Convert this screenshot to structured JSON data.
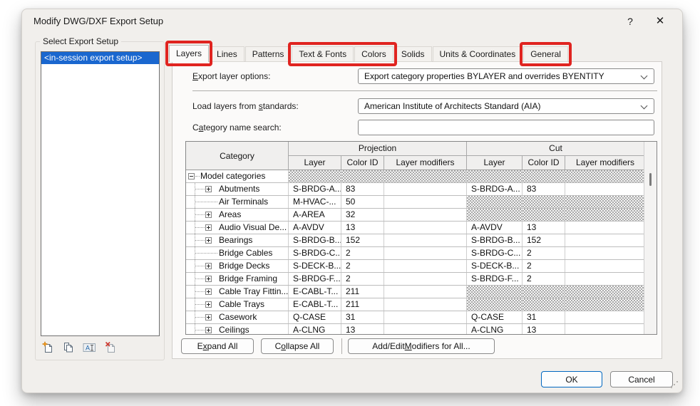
{
  "colors": {
    "annotation_red": "#e02420",
    "selection_blue": "#1a67cf",
    "ok_border_blue": "#0067c0"
  },
  "window": {
    "title": "Modify DWG/DXF Export Setup",
    "help_glyph": "?",
    "close_glyph": "✕"
  },
  "left_panel": {
    "group_label": "Select Export Setup",
    "list_items": [
      {
        "label": "<in-session export setup>",
        "selected": true
      }
    ],
    "toolbar_icons": [
      "new-export-setup",
      "duplicate-export-setup",
      "rename-export-setup",
      "delete-export-setup"
    ]
  },
  "tabs": [
    {
      "label": "Layers",
      "active": true,
      "highlight": true
    },
    {
      "label": "Lines"
    },
    {
      "label": "Patterns"
    },
    {
      "label": "Text & Fonts",
      "highlight": true
    },
    {
      "label": "Colors",
      "highlight": true
    },
    {
      "label": "Solids"
    },
    {
      "label": "Units & Coordinates"
    },
    {
      "label": "General",
      "highlight": true
    }
  ],
  "fields": {
    "export_layer_options": {
      "label": {
        "pre": "",
        "accel": "E",
        "post": "xport layer options:"
      },
      "value": "Export category properties BYLAYER and overrides BYENTITY"
    },
    "load_layers": {
      "label": {
        "pre": "Load layers from ",
        "accel": "s",
        "post": "tandards:"
      },
      "value": "American Institute of Architects Standard (AIA)"
    },
    "category_search": {
      "label": {
        "pre": "C",
        "accel": "a",
        "post": "tegory name search:"
      },
      "value": "",
      "placeholder": ""
    }
  },
  "table": {
    "headers": {
      "category": "Category",
      "projection": "Projection",
      "cut": "Cut",
      "layer": "Layer",
      "color_id": "Color ID",
      "layer_modifiers": "Layer modifiers"
    },
    "rows": [
      {
        "level": 0,
        "expand": "minus",
        "category": "Model categories",
        "p_layer": "",
        "p_color": "",
        "p_mod": "",
        "c_layer": "",
        "c_color": "",
        "c_mod": "",
        "proj_hatched": true,
        "cut_hatched": true
      },
      {
        "level": 1,
        "expand": "plus",
        "category": "Abutments",
        "p_layer": "S-BRDG-A...",
        "p_color": "83",
        "p_mod": "",
        "c_layer": "S-BRDG-A...",
        "c_color": "83",
        "c_mod": "",
        "proj_hatched": false,
        "cut_hatched": false
      },
      {
        "level": 1,
        "expand": "none",
        "category": "Air Terminals",
        "p_layer": "M-HVAC-...",
        "p_color": "50",
        "p_mod": "",
        "c_layer": "",
        "c_color": "",
        "c_mod": "",
        "proj_hatched": false,
        "cut_hatched": true
      },
      {
        "level": 1,
        "expand": "plus",
        "category": "Areas",
        "p_layer": "A-AREA",
        "p_color": "32",
        "p_mod": "",
        "c_layer": "",
        "c_color": "",
        "c_mod": "",
        "proj_hatched": false,
        "cut_hatched": true
      },
      {
        "level": 1,
        "expand": "plus",
        "category": "Audio Visual De...",
        "p_layer": "A-AVDV",
        "p_color": "13",
        "p_mod": "",
        "c_layer": "A-AVDV",
        "c_color": "13",
        "c_mod": "",
        "proj_hatched": false,
        "cut_hatched": false
      },
      {
        "level": 1,
        "expand": "plus",
        "category": "Bearings",
        "p_layer": "S-BRDG-B...",
        "p_color": "152",
        "p_mod": "",
        "c_layer": "S-BRDG-B...",
        "c_color": "152",
        "c_mod": "",
        "proj_hatched": false,
        "cut_hatched": false
      },
      {
        "level": 1,
        "expand": "none",
        "category": "Bridge Cables",
        "p_layer": "S-BRDG-C...",
        "p_color": "2",
        "p_mod": "",
        "c_layer": "S-BRDG-C...",
        "c_color": "2",
        "c_mod": "",
        "proj_hatched": false,
        "cut_hatched": false
      },
      {
        "level": 1,
        "expand": "plus",
        "category": "Bridge Decks",
        "p_layer": "S-DECK-B...",
        "p_color": "2",
        "p_mod": "",
        "c_layer": "S-DECK-B...",
        "c_color": "2",
        "c_mod": "",
        "proj_hatched": false,
        "cut_hatched": false
      },
      {
        "level": 1,
        "expand": "plus",
        "category": "Bridge Framing",
        "p_layer": "S-BRDG-F...",
        "p_color": "2",
        "p_mod": "",
        "c_layer": "S-BRDG-F...",
        "c_color": "2",
        "c_mod": "",
        "proj_hatched": false,
        "cut_hatched": false
      },
      {
        "level": 1,
        "expand": "plus",
        "category": "Cable Tray Fittin...",
        "p_layer": "E-CABL-T...",
        "p_color": "211",
        "p_mod": "",
        "c_layer": "",
        "c_color": "",
        "c_mod": "",
        "proj_hatched": false,
        "cut_hatched": true
      },
      {
        "level": 1,
        "expand": "plus",
        "category": "Cable Trays",
        "p_layer": "E-CABL-T...",
        "p_color": "211",
        "p_mod": "",
        "c_layer": "",
        "c_color": "",
        "c_mod": "",
        "proj_hatched": false,
        "cut_hatched": true
      },
      {
        "level": 1,
        "expand": "plus",
        "category": "Casework",
        "p_layer": "Q-CASE",
        "p_color": "31",
        "p_mod": "",
        "c_layer": "Q-CASE",
        "c_color": "31",
        "c_mod": "",
        "proj_hatched": false,
        "cut_hatched": false
      },
      {
        "level": 1,
        "expand": "plus",
        "category": "Ceilings",
        "p_layer": "A-CLNG",
        "p_color": "13",
        "p_mod": "",
        "c_layer": "A-CLNG",
        "c_color": "13",
        "c_mod": "",
        "proj_hatched": false,
        "cut_hatched": false
      }
    ]
  },
  "table_buttons": {
    "expand_all": {
      "pre": "E",
      "accel": "x",
      "post": "pand All"
    },
    "collapse_all": {
      "pre": "C",
      "accel": "o",
      "post": "llapse All"
    },
    "add_edit_modifiers": {
      "pre": "Add/Edit ",
      "accel": "M",
      "post": "odifiers for All..."
    }
  },
  "footer": {
    "ok_label": "OK",
    "cancel_label": "Cancel"
  }
}
